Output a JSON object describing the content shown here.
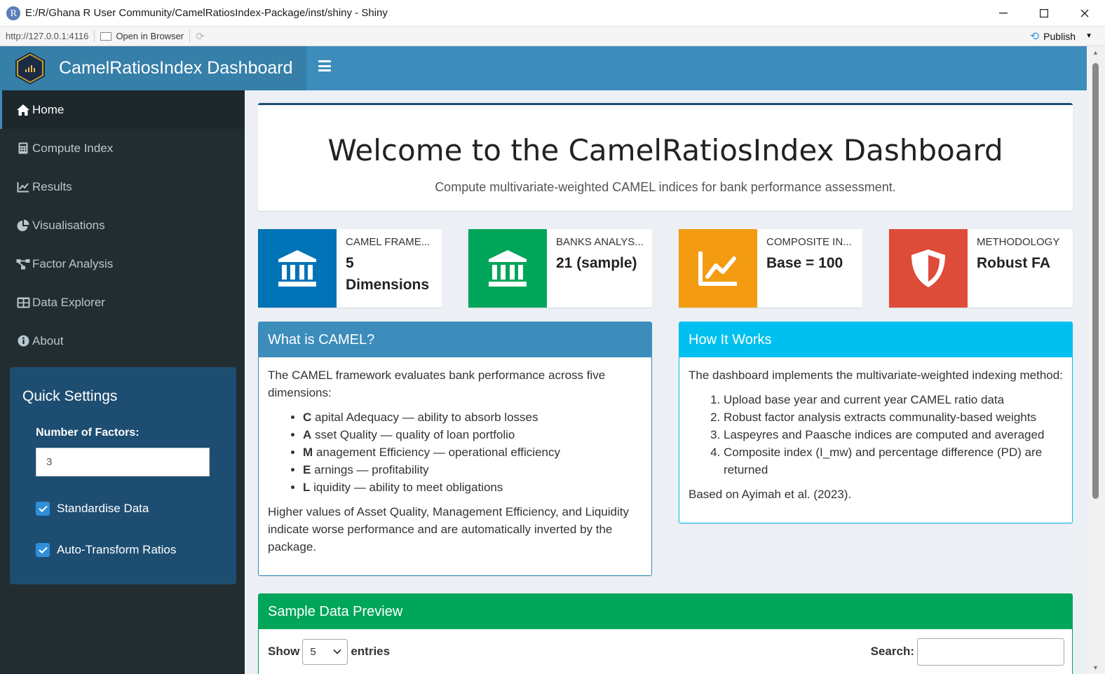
{
  "window": {
    "title": "E:/R/Ghana R User Community/CamelRatiosIndex-Package/inst/shiny - Shiny",
    "app_icon_letter": "R"
  },
  "addressbar": {
    "url": "http://127.0.0.1:4116",
    "open_in_browser": "Open in Browser",
    "publish": "Publish"
  },
  "header": {
    "brand": "CamelRatiosIndex Dashboard"
  },
  "sidebar": {
    "items": [
      {
        "label": "Home",
        "icon": "home-icon"
      },
      {
        "label": "Compute Index",
        "icon": "calculator-icon"
      },
      {
        "label": "Results",
        "icon": "line-chart-icon"
      },
      {
        "label": "Visualisations",
        "icon": "pie-chart-icon"
      },
      {
        "label": "Factor Analysis",
        "icon": "network-icon"
      },
      {
        "label": "Data Explorer",
        "icon": "table-icon"
      },
      {
        "label": "About",
        "icon": "info-icon"
      }
    ],
    "active_index": 0,
    "quick_settings": {
      "title": "Quick Settings",
      "factors_label": "Number of Factors:",
      "factors_value": "3",
      "standardise_label": "Standardise Data",
      "standardise_checked": true,
      "autotransform_label": "Auto-Transform Ratios",
      "autotransform_checked": true
    }
  },
  "welcome": {
    "title": "Welcome to the CamelRatiosIndex Dashboard",
    "subtitle": "Compute multivariate-weighted CAMEL indices for bank performance assessment."
  },
  "info_boxes": [
    {
      "label": "CAMEL FRAME...",
      "value": "5 Dimensions",
      "color": "#0073b7",
      "icon": "bank-icon"
    },
    {
      "label": "BANKS ANALYS...",
      "value": "21 (sample)",
      "color": "#00a65a",
      "icon": "bank-icon"
    },
    {
      "label": "COMPOSITE IN...",
      "value": "Base = 100",
      "color": "#f39c12",
      "icon": "line-chart-icon"
    },
    {
      "label": "METHODOLOGY",
      "value": "Robust FA",
      "color": "#dd4b39",
      "icon": "shield-icon"
    }
  ],
  "camel_box": {
    "title": "What is CAMEL?",
    "intro": "The CAMEL framework evaluates bank performance across five dimensions:",
    "items": [
      {
        "letter": "C",
        "text": "apital Adequacy — ability to absorb losses"
      },
      {
        "letter": "A",
        "text": "sset Quality — quality of loan portfolio"
      },
      {
        "letter": "M",
        "text": "anagement Efficiency — operational efficiency"
      },
      {
        "letter": "E",
        "text": "arnings — profitability"
      },
      {
        "letter": "L",
        "text": "iquidity — ability to meet obligations"
      }
    ],
    "footer": "Higher values of Asset Quality, Management Efficiency, and Liquidity indicate worse performance and are automatically inverted by the package."
  },
  "how_box": {
    "title": "How It Works",
    "intro": "The dashboard implements the multivariate-weighted indexing method:",
    "steps": [
      "Upload base year and current year CAMEL ratio data",
      "Robust factor analysis extracts communality-based weights",
      "Laspeyres and Paasche indices are computed and averaged",
      "Composite index (I_mw) and percentage difference (PD) are returned"
    ],
    "footer": "Based on Ayimah et al. (2023)."
  },
  "sample_box": {
    "title": "Sample Data Preview",
    "show_label": "Show",
    "entries_value": "5",
    "entries_label": "entries",
    "search_label": "Search:"
  },
  "colors": {
    "header": "#3c8dbc",
    "logo_area": "#367fa9",
    "sidebar": "#222d32",
    "quick_box": "#1d4e72",
    "camel_header": "#3c8dbc",
    "how_header": "#00c0ef",
    "sample_header": "#00a65a"
  }
}
